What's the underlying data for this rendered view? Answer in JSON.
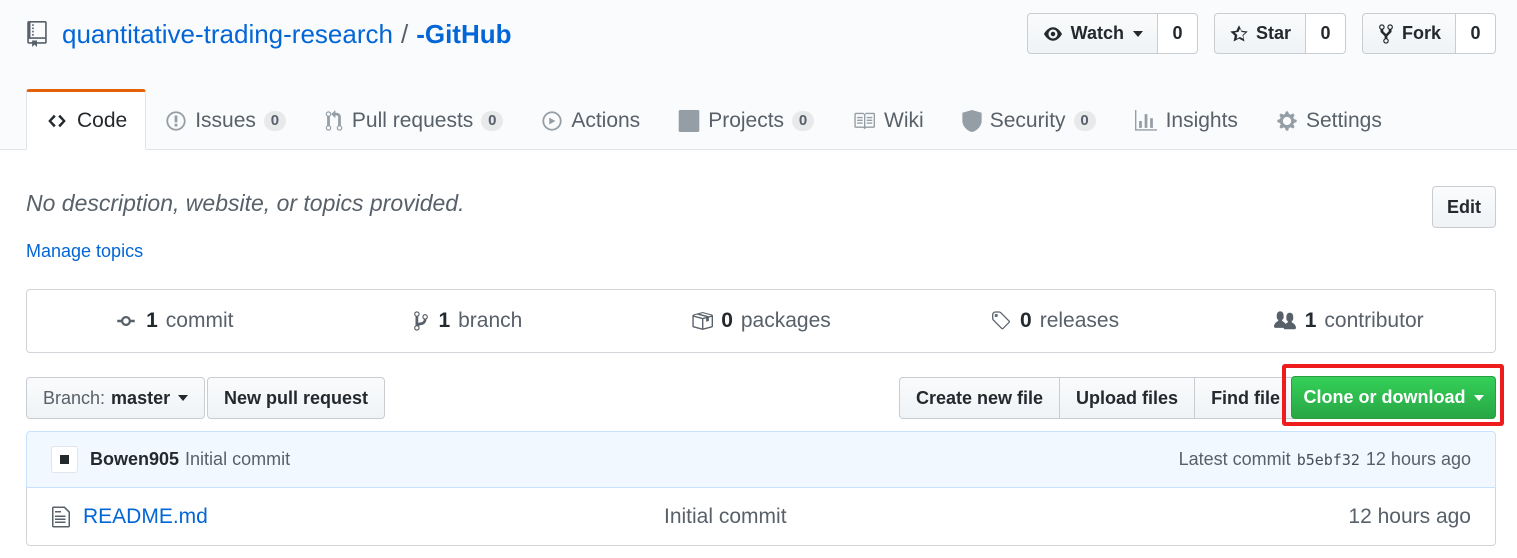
{
  "repo": {
    "owner": "quantitative-trading-research",
    "separator": "/",
    "name": "-GitHub"
  },
  "actions": {
    "watch": {
      "label": "Watch",
      "count": "0"
    },
    "star": {
      "label": "Star",
      "count": "0"
    },
    "fork": {
      "label": "Fork",
      "count": "0"
    }
  },
  "tabs": [
    {
      "label": "Code",
      "icon": "code-icon"
    },
    {
      "label": "Issues",
      "count": "0",
      "icon": "issue-icon"
    },
    {
      "label": "Pull requests",
      "count": "0",
      "icon": "pull-request-icon"
    },
    {
      "label": "Actions",
      "icon": "play-icon"
    },
    {
      "label": "Projects",
      "count": "0",
      "icon": "project-icon"
    },
    {
      "label": "Wiki",
      "icon": "book-icon"
    },
    {
      "label": "Security",
      "count": "0",
      "icon": "shield-icon"
    },
    {
      "label": "Insights",
      "icon": "graph-icon"
    },
    {
      "label": "Settings",
      "icon": "gear-icon"
    }
  ],
  "about": {
    "description": "No description, website, or topics provided.",
    "manage_topics": "Manage topics",
    "edit_label": "Edit"
  },
  "summary": [
    {
      "num": "1",
      "label": "commit",
      "icon": "commit-icon"
    },
    {
      "num": "1",
      "label": "branch",
      "icon": "branch-icon"
    },
    {
      "num": "0",
      "label": "packages",
      "icon": "package-icon"
    },
    {
      "num": "0",
      "label": "releases",
      "icon": "tag-icon"
    },
    {
      "num": "1",
      "label": "contributor",
      "icon": "people-icon"
    }
  ],
  "toolbar": {
    "branch_prefix": "Branch:",
    "branch_name": "master",
    "new_pr": "New pull request",
    "create_file": "Create new file",
    "upload_files": "Upload files",
    "find_file": "Find file",
    "clone": "Clone or download"
  },
  "commit": {
    "author": "Bowen905",
    "message": "Initial commit",
    "latest_label": "Latest commit",
    "sha": "b5ebf32",
    "age": "12 hours ago"
  },
  "files": [
    {
      "name": "README.md",
      "message": "Initial commit",
      "age": "12 hours ago",
      "icon": "file-icon"
    }
  ],
  "colors": {
    "link": "#0366d6",
    "accent_tab": "#e36209",
    "clone_green": "#28a745",
    "highlight": "#ee1c1c"
  }
}
